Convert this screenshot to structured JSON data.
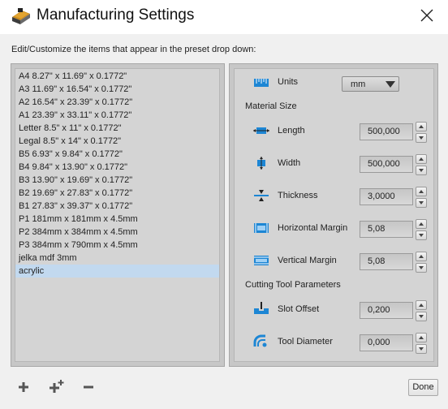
{
  "window": {
    "title": "Manufacturing Settings"
  },
  "instructions": "Edit/Customize the items that appear in the preset drop down:",
  "presets": [
    "A4 8.27\" x 11.69\" x 0.1772\"",
    "A3 11.69\" x 16.54\" x 0.1772\"",
    "A2 16.54\" x 23.39\" x 0.1772\"",
    "A1 23.39\" x 33.11\" x 0.1772\"",
    "Letter 8.5\" x 11\" x 0.1772\"",
    "Legal 8.5\" x 14\" x 0.1772\"",
    "B5 6.93\" x 9.84\" x 0.1772\"",
    "B4 9.84\" x 13.90\" x 0.1772\"",
    "B3 13.90\" x 19.69\" x 0.1772\"",
    "B2 19.69\" x 27.83\" x 0.1772\"",
    "B1 27.83\" x 39.37\" x 0.1772\"",
    "P1 181mm x 181mm x 4.5mm",
    "P2 384mm x 384mm x 4.5mm",
    "P3 384mm x 790mm x 4.5mm",
    "jelka mdf 3mm",
    "acrylic"
  ],
  "selected_preset": "acrylic",
  "units": {
    "label": "Units",
    "value": "mm"
  },
  "material_size": {
    "heading": "Material Size",
    "length": {
      "label": "Length",
      "value": "500,000"
    },
    "width": {
      "label": "Width",
      "value": "500,000"
    },
    "thickness": {
      "label": "Thickness",
      "value": "3,0000"
    },
    "horizontal_margin": {
      "label": "Horizontal Margin",
      "value": "5,08"
    },
    "vertical_margin": {
      "label": "Vertical Margin",
      "value": "5,08"
    }
  },
  "cutting_tool": {
    "heading": "Cutting Tool Parameters",
    "slot_offset": {
      "label": "Slot Offset",
      "value": "0,200"
    },
    "tool_diameter": {
      "label": "Tool Diameter",
      "value": "0,000"
    }
  },
  "buttons": {
    "done": "Done"
  },
  "icons": {
    "app": "laser-cutter-icon",
    "close": "close-icon",
    "units": "ruler-icon",
    "length": "length-icon",
    "width": "width-icon",
    "thickness": "thickness-icon",
    "horizontal_margin": "horizontal-margin-icon",
    "vertical_margin": "vertical-margin-icon",
    "slot_offset": "slot-offset-icon",
    "tool_diameter": "tool-diameter-icon",
    "add": "add-icon",
    "add_multiple": "add-multiple-icon",
    "remove": "remove-icon"
  },
  "colors": {
    "accent_blue": "#1d86d4",
    "selection": "#c2d9ef",
    "panel_bg": "#d4d4d4"
  }
}
